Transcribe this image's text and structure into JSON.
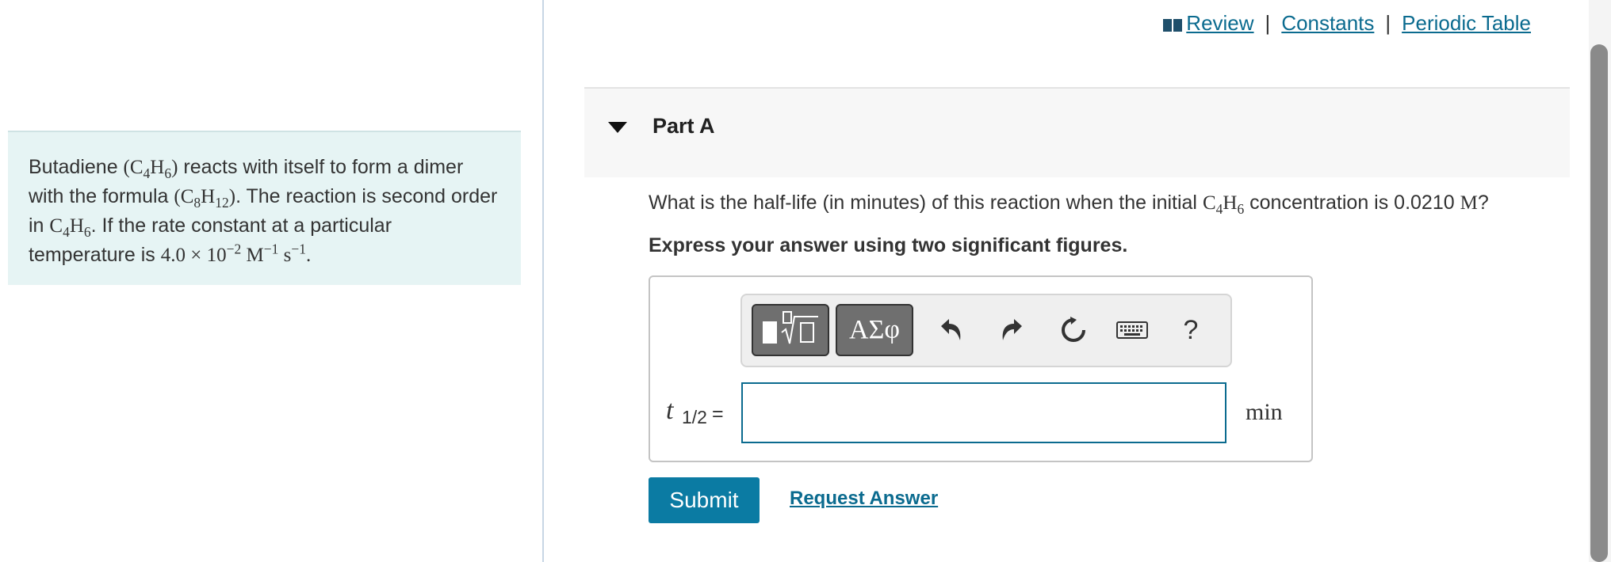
{
  "toplinks": {
    "review": "Review",
    "constants": "Constants",
    "periodic": "Periodic Table",
    "separator": "|"
  },
  "problem": {
    "text1": "Butadiene ",
    "formula1": "(C",
    "f1_sub1": "4",
    "f1_mid": "H",
    "f1_sub2": "6",
    "f1_end": ")",
    "text2": " reacts with itself to form a dimer with the formula ",
    "formula2": "(C",
    "f2_sub1": "8",
    "f2_mid": "H",
    "f2_sub2": "12",
    "f2_end": ")",
    "text3": ". The reaction is second order in ",
    "f3_c": "C",
    "f3_sub1": "4",
    "f3_h": "H",
    "f3_sub2": "6",
    "text4": ". If the rate constant at a particular temperature is ",
    "rate_value": "4.0 × 10",
    "rate_exp": "−2",
    "rate_unit1": " M",
    "rate_unit1_exp": "−1",
    "rate_unit2": " s",
    "rate_unit2_exp": "−1",
    "text5": "."
  },
  "part": {
    "title": "Part A"
  },
  "question": {
    "text1": "What is the half-life (in minutes) of this reaction when the initial ",
    "c": "C",
    "sub1": "4",
    "h": "H",
    "sub2": "6",
    "text2": " concentration is 0.0210 ",
    "unit": "M",
    "text3": "?"
  },
  "instruction": "Express your answer using two significant figures.",
  "toolbar": {
    "greek_label": "ΑΣφ",
    "help_label": "?"
  },
  "answer": {
    "variable": "t",
    "subscript": "1/2",
    "equals": "=",
    "value": "",
    "unit": "min"
  },
  "actions": {
    "submit": "Submit",
    "request": "Request Answer"
  },
  "colors": {
    "link": "#0b6b8f",
    "submit_bg": "#0b7ba3",
    "problem_bg": "#e6f4f4"
  }
}
